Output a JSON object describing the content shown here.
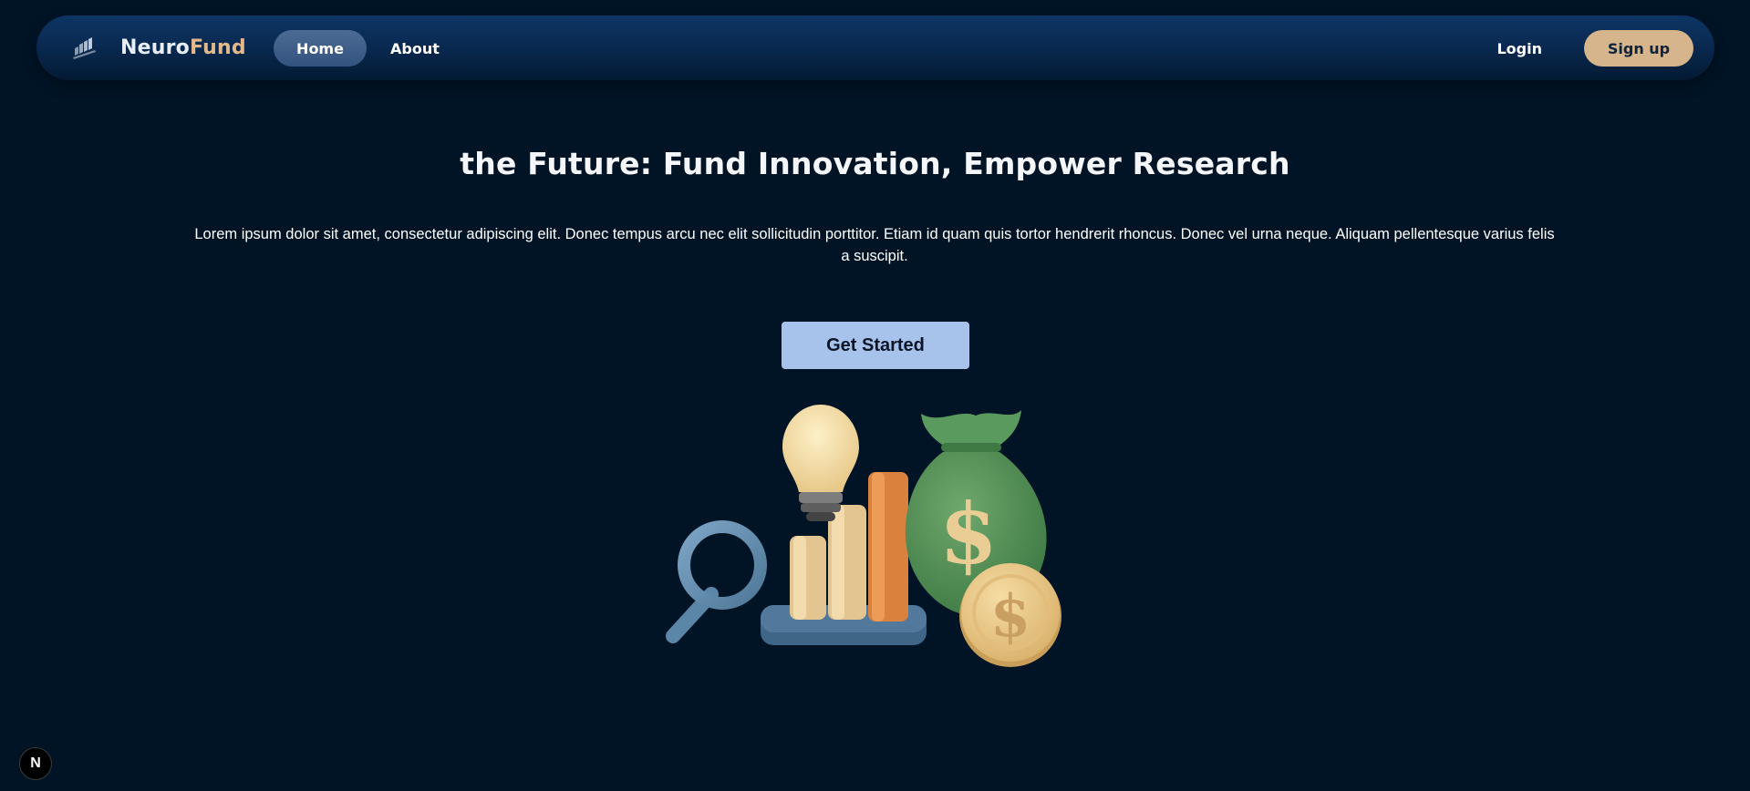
{
  "nav": {
    "brand_first": "Neuro",
    "brand_second": "Fund",
    "logo_icon": "bar-chart-icon",
    "links": [
      {
        "label": "Home",
        "active": true
      },
      {
        "label": "About",
        "active": false
      }
    ],
    "login_label": "Login",
    "signup_label": "Sign up"
  },
  "hero": {
    "title": "the Future: Fund Innovation, Empower Research",
    "description": "Lorem ipsum dolor sit amet, consectetur adipiscing elit. Donec tempus arcu nec elit sollicitudin porttitor. Etiam id quam quis tortor hendrerit rhoncus. Donec vel urna neque. Aliquam pellentesque varius felis a suscipit.",
    "cta_label": "Get Started",
    "illustration": "funding-research-illustration",
    "illustration_icons": [
      "magnifier-icon",
      "lightbulb-icon",
      "bar-chart-icon",
      "money-bag-icon",
      "dollar-coin-icon"
    ]
  },
  "badge": {
    "label": "N",
    "icon": "nextjs-icon"
  },
  "colors": {
    "background": "#011426",
    "nav_gradient_top": "#0d3564",
    "nav_gradient_bottom": "#031a33",
    "home_pill": "#3f5f89",
    "signup_button": "#d6b48c",
    "brand_accent": "#e3b98c",
    "cta_button": "#a7c3ec"
  }
}
